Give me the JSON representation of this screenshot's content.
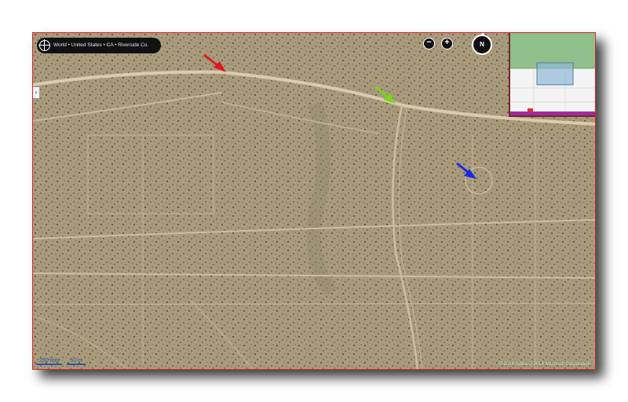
{
  "breadcrumb": {
    "text": "World • United States • CA • Riverside Co."
  },
  "controls": {
    "zoom_out": "−",
    "zoom_in": "+",
    "compass": "N",
    "side_toggle": "›"
  },
  "scale": {
    "imperial": "250 feet",
    "metric": "50 m"
  },
  "copyright": "© 2014 Nokia   © 2014 Microsoft Corporation",
  "arrows": [
    {
      "name": "red-arrow",
      "color": "#dd1a1a"
    },
    {
      "name": "green-arrow",
      "color": "#7ed321"
    },
    {
      "name": "blue-arrow",
      "color": "#1a2ae0"
    }
  ]
}
